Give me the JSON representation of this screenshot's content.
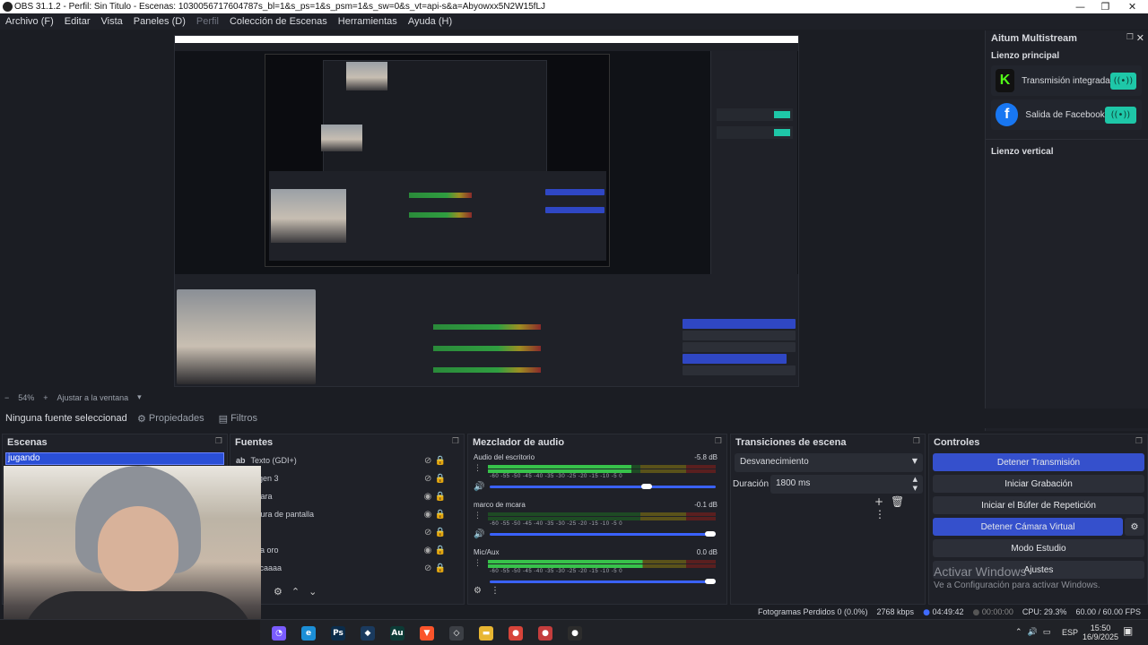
{
  "window": {
    "title": "OBS 31.1.2 - Perfil: Sin Titulo - Escenas: 1030056717604787s_bl=1&s_ps=1&s_psm=1&s_sw=0&s_vt=api-s&a=Abyowxx5N2W15fLJ",
    "minimize": "—",
    "maximize": "❐",
    "close": "✕"
  },
  "menubar": {
    "items": [
      "Archivo (F)",
      "Editar",
      "Vista",
      "Paneles (D)",
      "Perfil",
      "Colección de Escenas",
      "Herramientas",
      "Ayuda (H)"
    ]
  },
  "zoombar": {
    "minus": "−",
    "zoom": "54%",
    "plus": "+",
    "fit": "Ajustar a la ventana",
    "caret": "▾"
  },
  "multistream": {
    "title": "Aitum Multistream",
    "principal": "Lienzo principal",
    "outputs": [
      {
        "logo": "K",
        "label": "Transmisión integrada",
        "toggle": "((•))",
        "color": "#53fc18"
      },
      {
        "logo": "f",
        "label": "Salida de Facebook",
        "toggle": "((•))",
        "color": "#1877f2"
      }
    ],
    "vertical": "Lienzo vertical",
    "footer_icons": [
      "gear-icon",
      "heart-icon",
      "switch-icon"
    ]
  },
  "sourcebar": {
    "no_source": "Ninguna fuente seleccionad",
    "properties": "Propiedades",
    "filters": "Filtros"
  },
  "scenes": {
    "title": "Escenas",
    "items": [
      "jugando"
    ]
  },
  "sources": {
    "title": "Fuentes",
    "items": [
      "Texto (GDI+)",
      "agen 3",
      "mara",
      "ptura de pantalla",
      "",
      "dia oro",
      "sicaaaa"
    ]
  },
  "mixer": {
    "title": "Mezclador de audio",
    "ticks": "-60 -55 -50 -45 -40 -35 -30 -25 -20 -15 -10 -5 0",
    "channels": [
      {
        "name": "Audio del escritorio",
        "db": "-5.8 dB",
        "level": 0.63,
        "volume": 0.72
      },
      {
        "name": "marco de mcara",
        "db": "-0.1 dB",
        "level": 0.0,
        "volume": 1.0
      },
      {
        "name": "Mic/Aux",
        "db": "0.0 dB",
        "level": 0.68,
        "volume": 1.0
      }
    ]
  },
  "transitions": {
    "title": "Transiciones de escena",
    "selected": "Desvanecimiento",
    "duration_label": "Duración",
    "duration": "1800 ms"
  },
  "controls": {
    "title": "Controles",
    "buttons": [
      "Detener Transmisión",
      "Iniciar Grabación",
      "Iniciar el Búfer de Repetición",
      "Detener Cámara Virtual",
      "Modo Estudio",
      "Ajustes"
    ]
  },
  "activate_windows": {
    "line1": "Activar Windows",
    "line2": "Ve a Configuración para activar Windows."
  },
  "status": {
    "dropped": "Fotogramas Perdidos 0 (0.0%)",
    "bitrate": "2768 kbps",
    "stream_time": "04:49:42",
    "rec_time": "00:00:00",
    "cpu": "CPU: 29.3%",
    "fps": "60.00 / 60.00 FPS"
  },
  "taskbar": {
    "icons": [
      {
        "name": "copilot-icon",
        "glyph": "◔",
        "color": "#7a5cff"
      },
      {
        "name": "edge-icon",
        "glyph": "e",
        "color": "#1c8fd6"
      },
      {
        "name": "photoshop-icon",
        "glyph": "Ps",
        "color": "#0b2c4a"
      },
      {
        "name": "steam-icon",
        "glyph": "◆",
        "color": "#1a3a5e"
      },
      {
        "name": "audition-icon",
        "glyph": "Au",
        "color": "#0c3b36"
      },
      {
        "name": "brave-icon",
        "glyph": "▼",
        "color": "#fb542b"
      },
      {
        "name": "unity-icon",
        "glyph": "◇",
        "color": "#3c3f45"
      },
      {
        "name": "files-icon",
        "glyph": "▬",
        "color": "#e8b632"
      },
      {
        "name": "chrome-icon",
        "glyph": "●",
        "color": "#d7443a"
      },
      {
        "name": "app-icon",
        "glyph": "●",
        "color": "#c43d3d"
      },
      {
        "name": "obs-icon",
        "glyph": "●",
        "color": "#2c2c2c"
      }
    ],
    "lang": "ESP",
    "time": "15:50",
    "date": "16/9/2025"
  }
}
